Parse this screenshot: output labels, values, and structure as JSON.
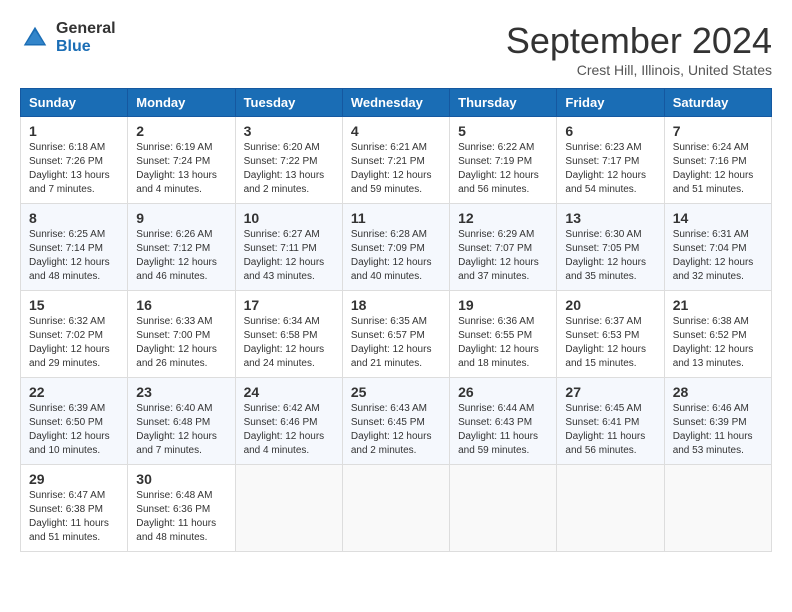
{
  "header": {
    "logo_general": "General",
    "logo_blue": "Blue",
    "title": "September 2024",
    "location": "Crest Hill, Illinois, United States"
  },
  "weekdays": [
    "Sunday",
    "Monday",
    "Tuesday",
    "Wednesday",
    "Thursday",
    "Friday",
    "Saturday"
  ],
  "weeks": [
    [
      {
        "day": "1",
        "info": "Sunrise: 6:18 AM\nSunset: 7:26 PM\nDaylight: 13 hours\nand 7 minutes."
      },
      {
        "day": "2",
        "info": "Sunrise: 6:19 AM\nSunset: 7:24 PM\nDaylight: 13 hours\nand 4 minutes."
      },
      {
        "day": "3",
        "info": "Sunrise: 6:20 AM\nSunset: 7:22 PM\nDaylight: 13 hours\nand 2 minutes."
      },
      {
        "day": "4",
        "info": "Sunrise: 6:21 AM\nSunset: 7:21 PM\nDaylight: 12 hours\nand 59 minutes."
      },
      {
        "day": "5",
        "info": "Sunrise: 6:22 AM\nSunset: 7:19 PM\nDaylight: 12 hours\nand 56 minutes."
      },
      {
        "day": "6",
        "info": "Sunrise: 6:23 AM\nSunset: 7:17 PM\nDaylight: 12 hours\nand 54 minutes."
      },
      {
        "day": "7",
        "info": "Sunrise: 6:24 AM\nSunset: 7:16 PM\nDaylight: 12 hours\nand 51 minutes."
      }
    ],
    [
      {
        "day": "8",
        "info": "Sunrise: 6:25 AM\nSunset: 7:14 PM\nDaylight: 12 hours\nand 48 minutes."
      },
      {
        "day": "9",
        "info": "Sunrise: 6:26 AM\nSunset: 7:12 PM\nDaylight: 12 hours\nand 46 minutes."
      },
      {
        "day": "10",
        "info": "Sunrise: 6:27 AM\nSunset: 7:11 PM\nDaylight: 12 hours\nand 43 minutes."
      },
      {
        "day": "11",
        "info": "Sunrise: 6:28 AM\nSunset: 7:09 PM\nDaylight: 12 hours\nand 40 minutes."
      },
      {
        "day": "12",
        "info": "Sunrise: 6:29 AM\nSunset: 7:07 PM\nDaylight: 12 hours\nand 37 minutes."
      },
      {
        "day": "13",
        "info": "Sunrise: 6:30 AM\nSunset: 7:05 PM\nDaylight: 12 hours\nand 35 minutes."
      },
      {
        "day": "14",
        "info": "Sunrise: 6:31 AM\nSunset: 7:04 PM\nDaylight: 12 hours\nand 32 minutes."
      }
    ],
    [
      {
        "day": "15",
        "info": "Sunrise: 6:32 AM\nSunset: 7:02 PM\nDaylight: 12 hours\nand 29 minutes."
      },
      {
        "day": "16",
        "info": "Sunrise: 6:33 AM\nSunset: 7:00 PM\nDaylight: 12 hours\nand 26 minutes."
      },
      {
        "day": "17",
        "info": "Sunrise: 6:34 AM\nSunset: 6:58 PM\nDaylight: 12 hours\nand 24 minutes."
      },
      {
        "day": "18",
        "info": "Sunrise: 6:35 AM\nSunset: 6:57 PM\nDaylight: 12 hours\nand 21 minutes."
      },
      {
        "day": "19",
        "info": "Sunrise: 6:36 AM\nSunset: 6:55 PM\nDaylight: 12 hours\nand 18 minutes."
      },
      {
        "day": "20",
        "info": "Sunrise: 6:37 AM\nSunset: 6:53 PM\nDaylight: 12 hours\nand 15 minutes."
      },
      {
        "day": "21",
        "info": "Sunrise: 6:38 AM\nSunset: 6:52 PM\nDaylight: 12 hours\nand 13 minutes."
      }
    ],
    [
      {
        "day": "22",
        "info": "Sunrise: 6:39 AM\nSunset: 6:50 PM\nDaylight: 12 hours\nand 10 minutes."
      },
      {
        "day": "23",
        "info": "Sunrise: 6:40 AM\nSunset: 6:48 PM\nDaylight: 12 hours\nand 7 minutes."
      },
      {
        "day": "24",
        "info": "Sunrise: 6:42 AM\nSunset: 6:46 PM\nDaylight: 12 hours\nand 4 minutes."
      },
      {
        "day": "25",
        "info": "Sunrise: 6:43 AM\nSunset: 6:45 PM\nDaylight: 12 hours\nand 2 minutes."
      },
      {
        "day": "26",
        "info": "Sunrise: 6:44 AM\nSunset: 6:43 PM\nDaylight: 11 hours\nand 59 minutes."
      },
      {
        "day": "27",
        "info": "Sunrise: 6:45 AM\nSunset: 6:41 PM\nDaylight: 11 hours\nand 56 minutes."
      },
      {
        "day": "28",
        "info": "Sunrise: 6:46 AM\nSunset: 6:39 PM\nDaylight: 11 hours\nand 53 minutes."
      }
    ],
    [
      {
        "day": "29",
        "info": "Sunrise: 6:47 AM\nSunset: 6:38 PM\nDaylight: 11 hours\nand 51 minutes."
      },
      {
        "day": "30",
        "info": "Sunrise: 6:48 AM\nSunset: 6:36 PM\nDaylight: 11 hours\nand 48 minutes."
      },
      {
        "day": "",
        "info": ""
      },
      {
        "day": "",
        "info": ""
      },
      {
        "day": "",
        "info": ""
      },
      {
        "day": "",
        "info": ""
      },
      {
        "day": "",
        "info": ""
      }
    ]
  ]
}
